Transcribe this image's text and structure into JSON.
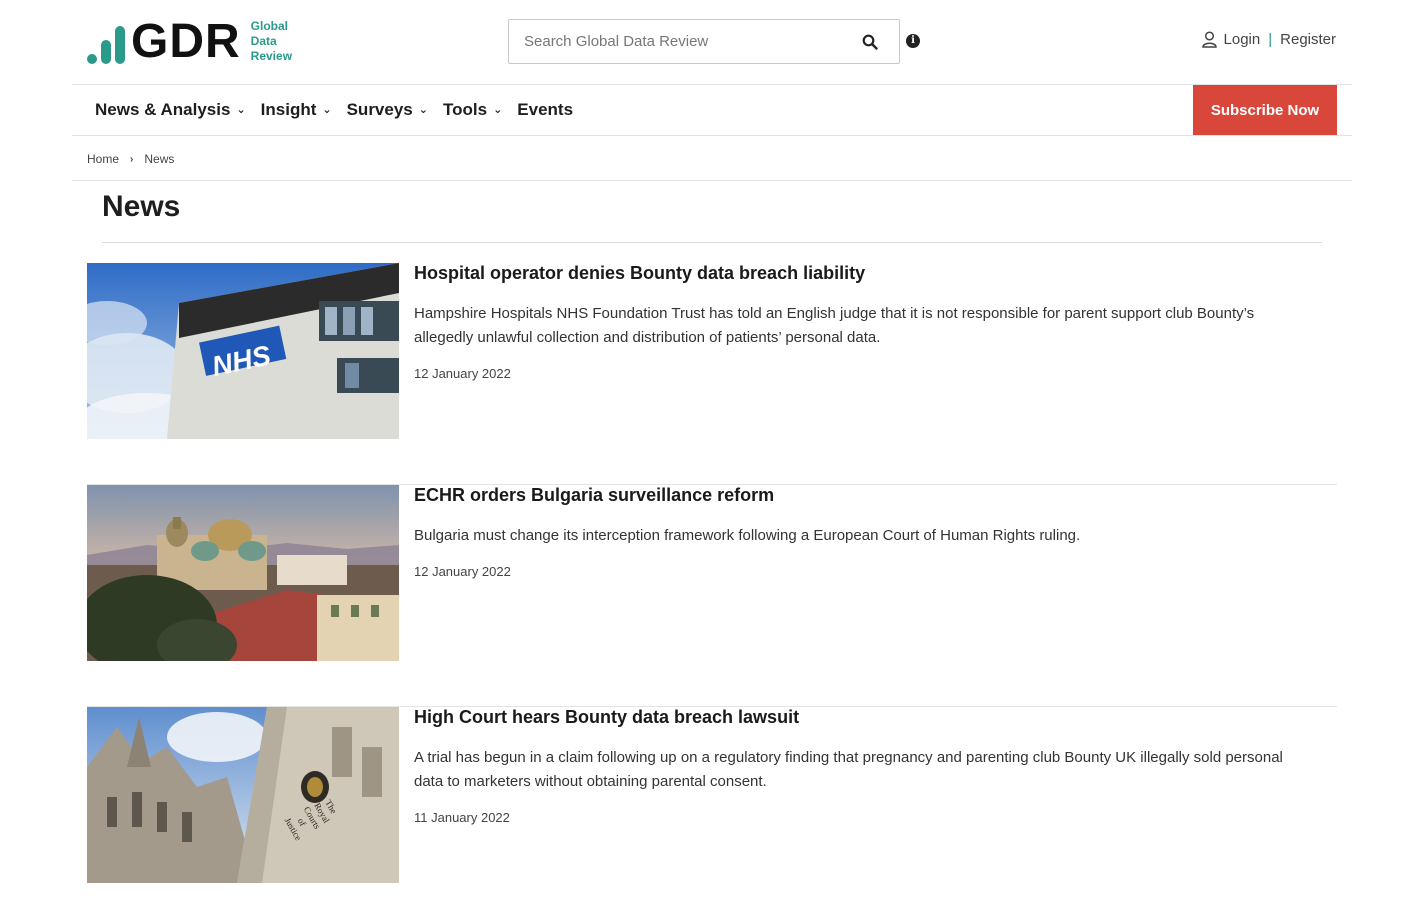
{
  "brand": {
    "logo_text": "GDR",
    "sub_lines": [
      "Global",
      "Data",
      "Review"
    ],
    "accent_color": "#2a9a8a"
  },
  "search": {
    "placeholder": "Search Global Data Review",
    "button_icon": "search-icon",
    "info_icon": "info-icon"
  },
  "account": {
    "login_label": "Login",
    "separator": "|",
    "register_label": "Register",
    "icon": "user-icon"
  },
  "nav": {
    "items": [
      {
        "label": "News & Analysis",
        "has_dropdown": true
      },
      {
        "label": "Insight",
        "has_dropdown": true
      },
      {
        "label": "Surveys",
        "has_dropdown": true
      },
      {
        "label": "Tools",
        "has_dropdown": true
      },
      {
        "label": "Events",
        "has_dropdown": false
      }
    ],
    "subscribe_label": "Subscribe Now",
    "subscribe_color": "#d9473b"
  },
  "breadcrumb": {
    "items": [
      "Home",
      "News"
    ]
  },
  "page": {
    "title": "News"
  },
  "articles": [
    {
      "headline": "Hospital operator denies Bounty data breach liability",
      "summary": "Hampshire Hospitals NHS Foundation Trust has told an English judge that it is not responsible for parent support club Bounty’s allegedly unlawful collection and distribution of patients’ personal data.",
      "date": "12 January 2022",
      "image_text": "NHS"
    },
    {
      "headline": "ECHR orders Bulgaria surveillance reform",
      "summary": "Bulgaria must change its interception framework following a European Court of Human Rights ruling.",
      "date": "12 January 2022"
    },
    {
      "headline": "High Court hears Bounty data breach lawsuit",
      "summary": "A trial has begun in a claim following up on a regulatory finding that pregnancy and parenting club Bounty UK illegally sold personal data to marketers without obtaining parental consent.",
      "date": "11 January 2022",
      "image_text": [
        "The",
        "Royal",
        "Courts",
        "of",
        "Justice"
      ]
    }
  ]
}
